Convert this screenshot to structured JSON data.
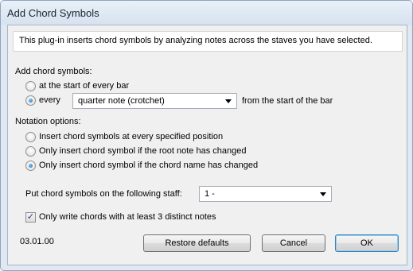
{
  "window": {
    "title": "Add Chord Symbols"
  },
  "intro": "This plug-in inserts chord symbols by analyzing notes across the staves you have selected.",
  "add_section": {
    "label": "Add chord symbols:",
    "option_start": "at the start of every bar",
    "option_every": "every",
    "selected": "every",
    "interval_select_value": "quarter note (crotchet)",
    "suffix": "from the start of the bar"
  },
  "notation": {
    "label": "Notation options:",
    "options": [
      "Insert chord symbols at every specified position",
      "Only insert chord symbol if the root note has changed",
      "Only insert chord symbol if the chord name has changed"
    ],
    "selected_index": 2
  },
  "staff": {
    "label": "Put chord symbols on the following staff:",
    "select_value": "1 -"
  },
  "distinct_notes": {
    "label": "Only write chords with at least 3 distinct notes",
    "checked": true
  },
  "footer": {
    "version": "03.01.00",
    "restore_label": "Restore defaults",
    "cancel_label": "Cancel",
    "ok_label": "OK"
  },
  "icons": {
    "check": "checkmark-icon",
    "dropdown": "chevron-down-icon"
  },
  "colors": {
    "frame": "#dfe8f3",
    "panel": "#f0f0f0",
    "radio_dot": "#1b5fae",
    "default_button_border": "#3c7fb1"
  }
}
